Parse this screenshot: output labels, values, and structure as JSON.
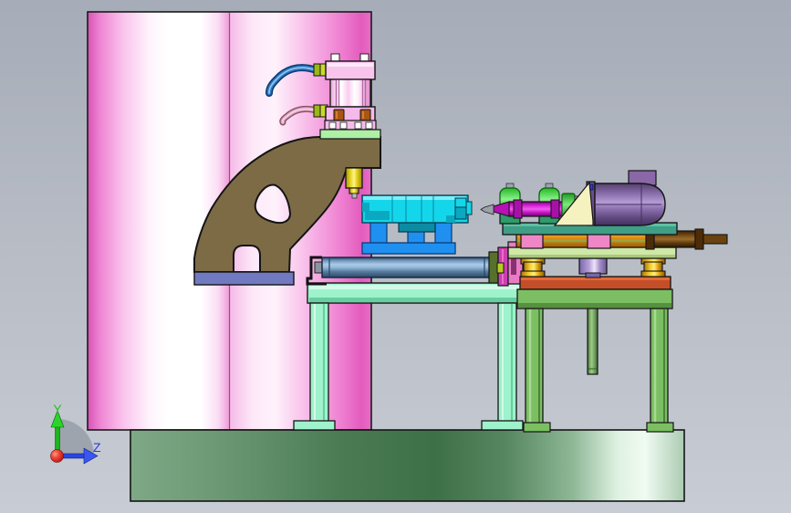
{
  "axis_triad": {
    "y_label": "Y",
    "z_label": "Z",
    "y_color": "#1fc41f",
    "z_color": "#2a3ae0",
    "origin_color": "#d01818"
  },
  "colors": {
    "background_gray": "#b8bdc6",
    "column_pink": "#f2a6e0",
    "column_edge_magenta": "#d652b4",
    "plinth_green": "#4a7b53",
    "arm_olive": "#7d6b46",
    "arm_base_slate": "#7179c1",
    "cap_plate_green": "#aef0a6",
    "cylinder_pink": "#f8c4ec",
    "fitting_chartreuse": "#c8dc28",
    "tube_blue": "#2f76c0",
    "tube_pink": "#d8a0bc",
    "spindle_yellow": "#f4e63c",
    "spindle_tip_gray": "#b8bcc0",
    "fixture_cyan": "#14d6ea",
    "fixture_shade": "#0ba8c2",
    "fixture_blue": "#2090f0",
    "slide_cylinder_steel": "#6f94b8",
    "slide_ring_olive": "#55712c",
    "slide_disc_magenta": "#cc3fb0",
    "slide_block_pink": "#e87cc4",
    "table_left_mint": "#9ef2cc",
    "table_right_green": "#7bbf62",
    "table_right_red": "#c44e28",
    "support_gold": "#f6d030",
    "support_lavender": "#b4a0d8",
    "plate_pale_green": "#cfe8a8",
    "rail_orange": "#d88614",
    "carriage_pink": "#ef86c6",
    "clamp_brown": "#6a4210",
    "clamp_flange_brown": "#4e2c06",
    "base_plate_teal": "#3f9e85",
    "bearing_green": "#35c235",
    "pedestal_green": "#2f9a6a",
    "shaft_magenta": "#c013c0",
    "coupling_green": "#3ecc30",
    "motor_purple": "#8a68a8",
    "bracket_cream": "#f6f2c0",
    "white_bolt": "#ffffff",
    "copper_nut": "#a85612"
  }
}
